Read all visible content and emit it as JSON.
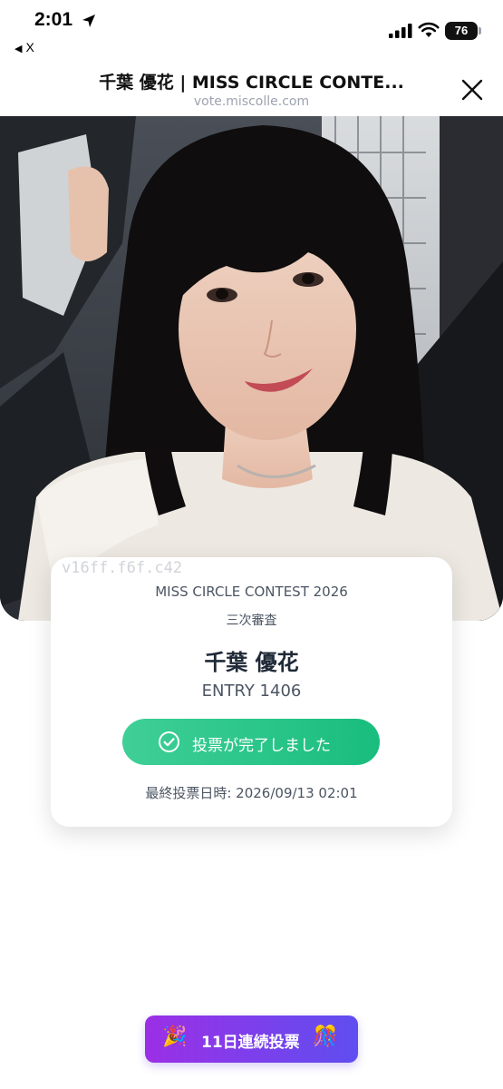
{
  "status_bar": {
    "time": "2:01",
    "back_app": "X",
    "battery": "76"
  },
  "browser": {
    "title": "千葉 優花 | MISS CIRCLE CONTE...",
    "url": "vote.miscolle.com"
  },
  "card": {
    "watermark": "v16ff.f6f.c42",
    "contest": "MISS CIRCLE CONTEST 2026",
    "stage": "三次審査",
    "name": "千葉 優花",
    "entry": "ENTRY 1406",
    "vote_status": "投票が完了しました",
    "last_vote": "最終投票日時: 2026/09/13 02:01"
  },
  "streak": {
    "emoji_left": "🎉",
    "label": "11日連続投票",
    "emoji_right": "🎊"
  },
  "colors": {
    "vote_green": "#1fc283",
    "streak_purple": "#9b2fe6",
    "streak_indigo": "#5f4ef0"
  }
}
